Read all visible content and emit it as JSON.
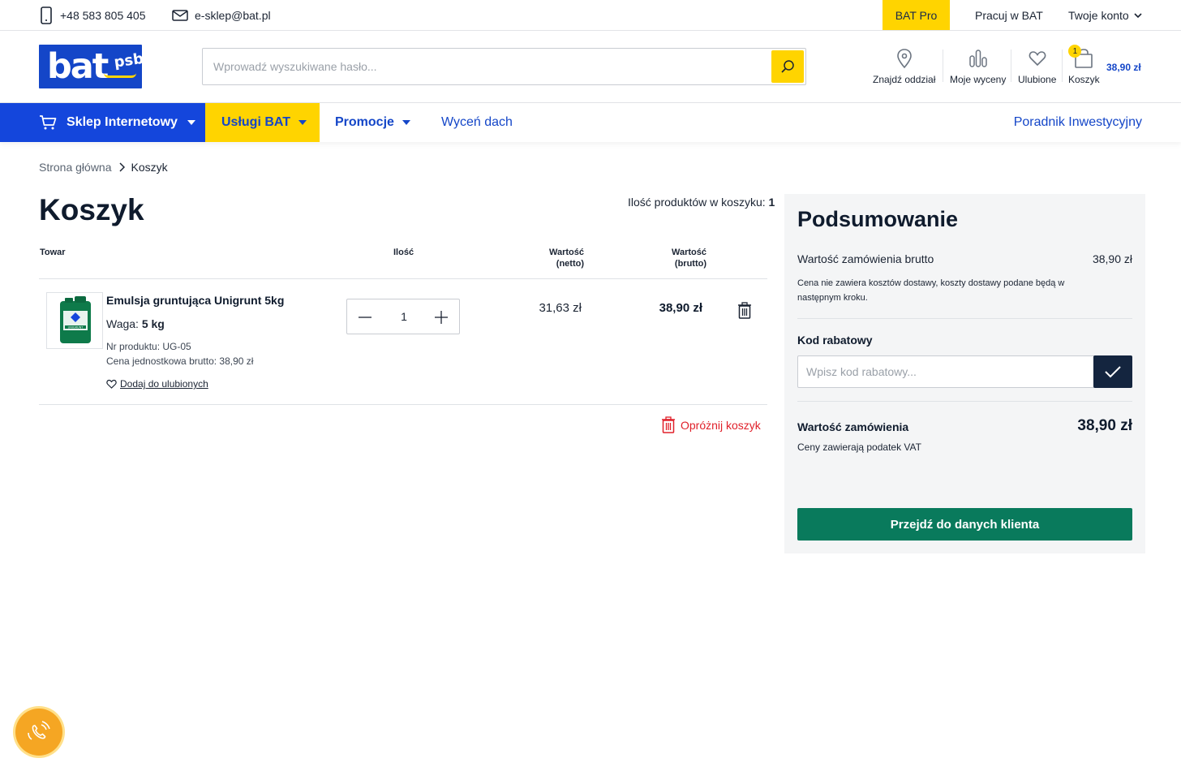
{
  "topbar": {
    "phone": "+48 583 805 405",
    "email": "e-sklep@bat.pl",
    "bat_pro": "BAT Pro",
    "pracuj": "Pracuj w BAT",
    "konto": "Twoje konto"
  },
  "header": {
    "logo_text": "bat",
    "logo_sub": "psb",
    "search_placeholder": "Wprowadź wyszukiwane hasło...",
    "icons": {
      "branch": "Znajdź oddział",
      "quotes": "Moje wyceny",
      "favorites": "Ulubione",
      "cart": "Koszyk",
      "cart_count": "1",
      "cart_total": "38,90 zł"
    }
  },
  "nav": {
    "shop": "Sklep Internetowy",
    "services": "Usługi BAT",
    "promo": "Promocje",
    "roof": "Wyceń dach",
    "guide": "Poradnik Inwestycyjny"
  },
  "breadcrumb": {
    "home": "Strona główna",
    "current": "Koszyk"
  },
  "cart": {
    "title": "Koszyk",
    "count_label": "Ilość produktów w koszyku:",
    "count_value": "1",
    "headers": {
      "product": "Towar",
      "qty": "Ilość",
      "net_line1": "Wartość",
      "net_line2": "(netto)",
      "gross_line1": "Wartość",
      "gross_line2": "(brutto)"
    },
    "item": {
      "name": "Emulsja gruntująca Unigrunt 5kg",
      "weight_label": "Waga:",
      "weight_value": "5 kg",
      "sku": "Nr produktu: UG-05",
      "unit_price": "Cena jednostkowa brutto: 38,90 zł",
      "add_fav": "Dodaj do ulubionych",
      "qty": "1",
      "net": "31,63 zł",
      "gross": "38,90 zł",
      "product_label": "UNIGRUNT"
    },
    "empty": "Opróżnij koszyk"
  },
  "summary": {
    "title": "Podsumowanie",
    "order_gross_label": "Wartość zamówienia brutto",
    "order_gross_value": "38,90 zł",
    "note": "Cena nie zawiera kosztów dostawy, koszty dostawy podane będą w następnym kroku.",
    "coupon_label": "Kod rabatowy",
    "coupon_placeholder": "Wpisz kod rabatowy...",
    "total_label": "Wartość zamówienia",
    "total_value": "38,90 zł",
    "vat_note": "Ceny zawierają podatek VAT",
    "proceed": "Przejdź do danych klienta"
  },
  "colors": {
    "brand_blue": "#1446dc",
    "brand_yellow": "#ffd400",
    "cta_green": "#097a5c",
    "danger_red": "#e0202a"
  }
}
